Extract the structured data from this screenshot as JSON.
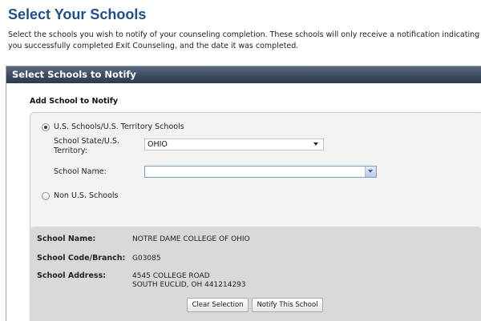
{
  "page": {
    "title": "Select Your Schools",
    "intro_line1": "Select the schools you wish to notify of your counseling completion. These schools will only receive a notification indicating that",
    "intro_line2": "you successfully completed Exit Counseling, and the date it was completed."
  },
  "panel": {
    "header": "Select Schools to Notify",
    "add_label": "Add School to Notify",
    "us_radio_label": "U.S. Schools/U.S. Territory Schools",
    "us_radio_selected": true,
    "state_label_line1": "School State/U.S.",
    "state_label_line2": "Territory:",
    "state_value": "OHIO",
    "school_name_label": "School Name:",
    "school_name_value": "",
    "non_us_radio_label": "Non U.S. Schools",
    "non_us_radio_selected": false
  },
  "selected_school": {
    "name_label": "School Name:",
    "name_value": "NOTRE DAME COLLEGE OF OHIO",
    "code_label": "School Code/Branch:",
    "code_value": "G03085",
    "address_label": "School Address:",
    "address_line1": "4545 COLLEGE ROAD",
    "address_line2": "SOUTH EUCLID, OH 441214293",
    "clear_button": "Clear Selection",
    "notify_button": "Notify This School"
  }
}
